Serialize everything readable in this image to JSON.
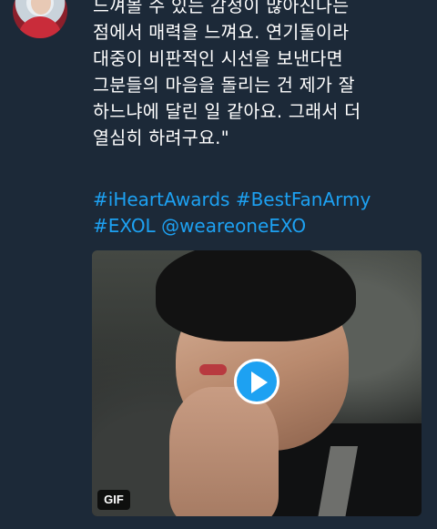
{
  "tweet": {
    "body_lines": [
      "느껴볼 수 있는 감정이 많아진다는",
      "점에서 매력을 느껴요. 연기돌이라",
      "대중이 비판적인 시선을 보낸다면",
      "그분들의 마음을 돌리는 건 제가 잘",
      "하느냐에 달린 일 같아요. 그래서 더",
      "열심히 하려구요.\""
    ],
    "hashtags": {
      "tag1": "#iHeartAwards",
      "tag2": "#BestFanArmy",
      "tag3": "#EXOL",
      "mention": "@weareoneEXO"
    },
    "media": {
      "badge": "GIF",
      "play_icon": "play-icon"
    }
  },
  "colors": {
    "background": "#1c2938",
    "text": "#ffffff",
    "link": "#1da1f2"
  }
}
